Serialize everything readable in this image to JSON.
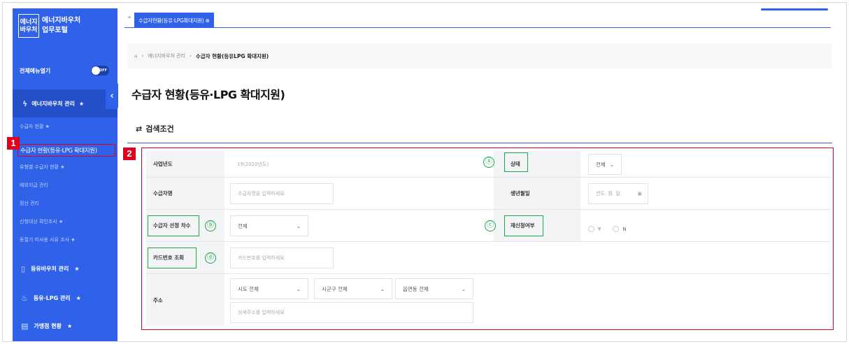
{
  "sidebar": {
    "logo_box": "에너지\n바우처",
    "logo_title_1": "에너지바우처",
    "logo_title_2": "업무포털",
    "menu_all_label": "전체메뉴열기",
    "toggle_label": "OFF",
    "active_menu": "에너지바우처 관리",
    "sub_items": [
      "수급자 현황",
      "수급자 현황(등유·LPG 확대지원)",
      "유형별 수급자 현황",
      "예외지급 관리",
      "정산 관리",
      "신청대상 확인조사",
      "동절기 미사용 사유 조사"
    ],
    "main_menus": [
      "등유바우처 관리",
      "등유·LPG 관리",
      "가맹점 현황"
    ]
  },
  "tab": {
    "label": "수급자현황(등유·LPG확대지원)"
  },
  "breadcrumb": {
    "home": "⌂",
    "items": [
      "에너지바우처 관리",
      "수급자 현황(등유LPG 확대지원)"
    ]
  },
  "page": {
    "title": "수급자 현황(등유·LPG 확대지원)",
    "search_heading": "검색조건"
  },
  "annotations": {
    "badge1": "1",
    "badge2": "2",
    "a": "ⓐ",
    "b": "ⓑ",
    "c": "ⓒ",
    "d": "ⓓ"
  },
  "form": {
    "year_label": "사업년도",
    "year_value": "19(2020년도)",
    "status_label": "상태",
    "status_value": "전체",
    "name_label": "수급자명",
    "name_placeholder": "수급자명을 입력하세요",
    "birth_label": "생년월일",
    "birth_placeholder": "연도. 월. 일.",
    "selection_label": "수급자 선정 차수",
    "selection_value": "전체",
    "reapply_label": "재신청여부",
    "reapply_y": "Y",
    "reapply_n": "N",
    "card_label": "카드번호 조회",
    "card_placeholder": "카드번호를 입력하세요",
    "address_label": "주소",
    "sido": "시도 전체",
    "sigungu": "시군구 전체",
    "eup": "읍면동 전체",
    "address_placeholder": "상세주소를 입력하세요"
  }
}
